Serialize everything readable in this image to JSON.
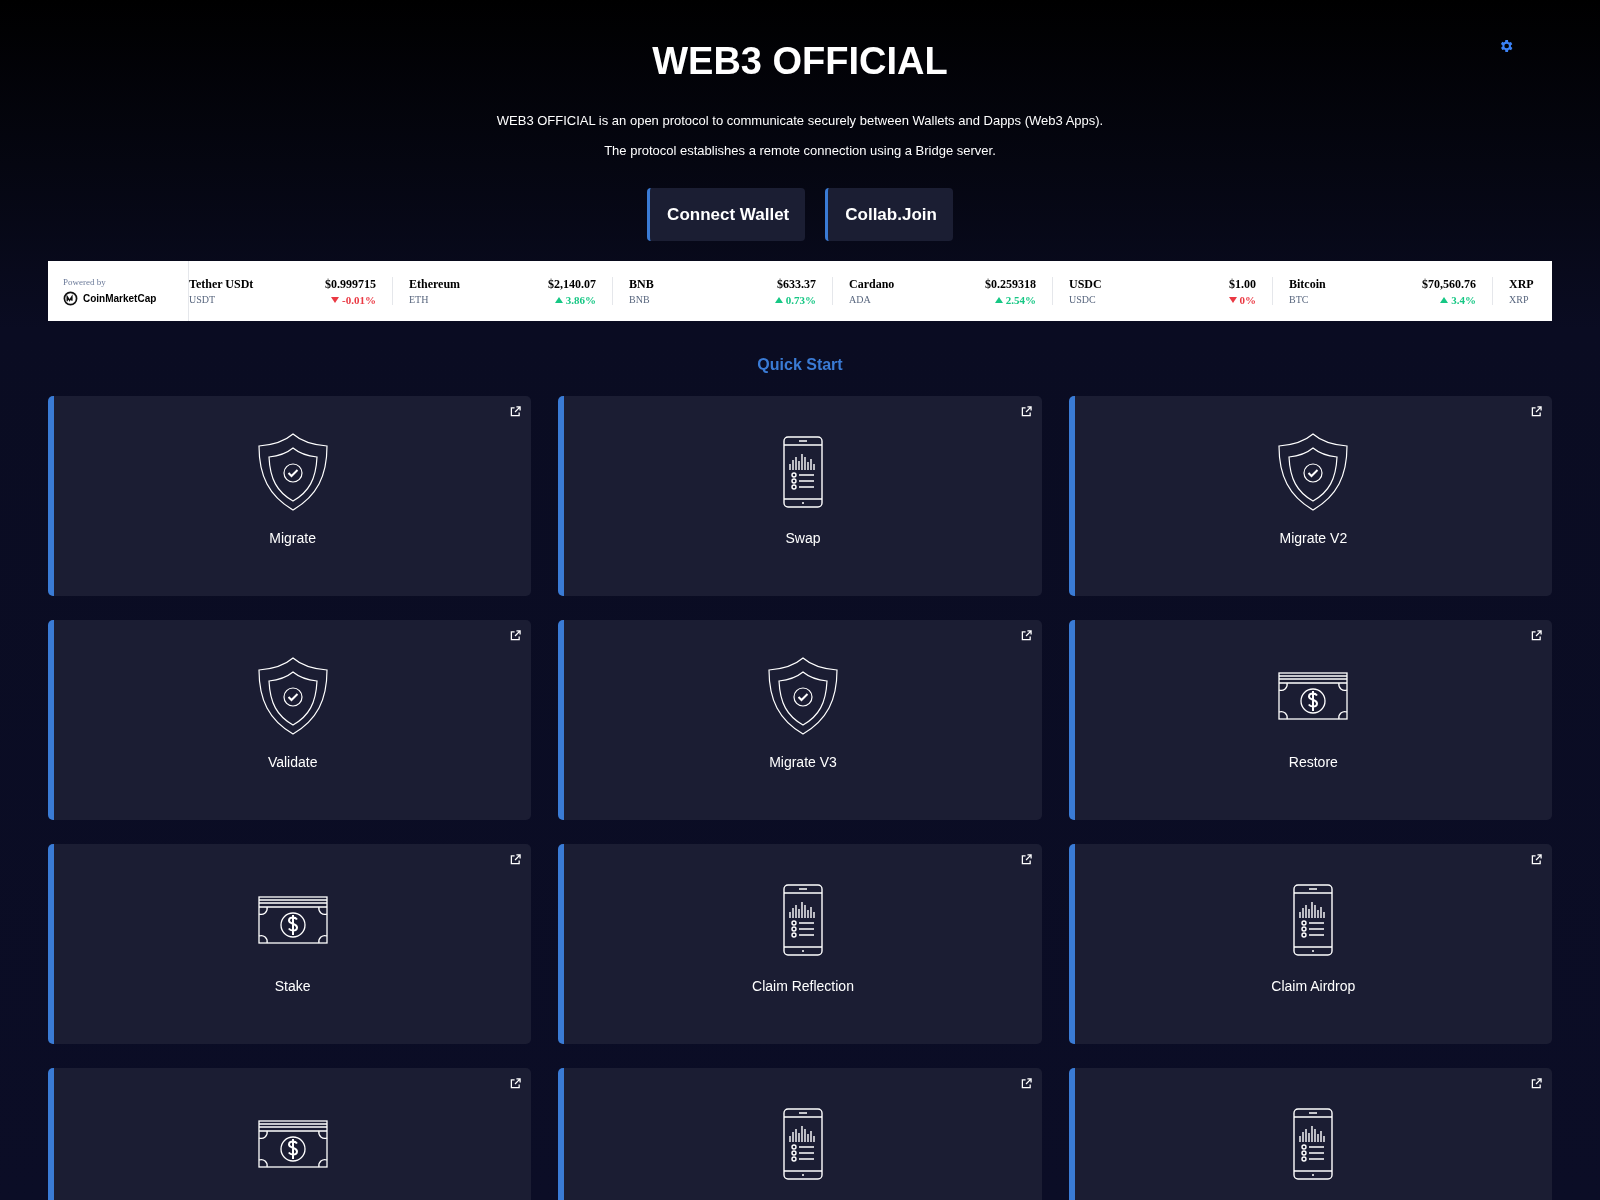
{
  "header": {
    "title": "WEB3 OFFICIAL",
    "lines": [
      "WEB3 OFFICIAL is an open protocol to communicate securely between Wallets and Dapps (Web3 Apps).",
      "The protocol establishes a remote connection using a Bridge server."
    ]
  },
  "buttons": [
    "Connect Wallet",
    "Collab.Join"
  ],
  "ticker": {
    "powered_by": "Powered by",
    "brand": "CoinMarketCap",
    "coins": [
      {
        "name": "Tether USDt",
        "symbol": "USDT",
        "price": "$0.999715",
        "change": "-0.01%",
        "falling": true
      },
      {
        "name": "Ethereum",
        "symbol": "ETH",
        "price": "$2,140.07",
        "change": "3.86%",
        "falling": false
      },
      {
        "name": "BNB",
        "symbol": "BNB",
        "price": "$633.37",
        "change": "0.73%",
        "falling": false
      },
      {
        "name": "Cardano",
        "symbol": "ADA",
        "price": "$0.259318",
        "change": "2.54%",
        "falling": false
      },
      {
        "name": "USDC",
        "symbol": "USDC",
        "price": "$1.00",
        "change": "0%",
        "falling": true
      },
      {
        "name": "Bitcoin",
        "symbol": "BTC",
        "price": "$70,560.76",
        "change": "3.4%",
        "falling": false
      },
      {
        "name": "XRP",
        "symbol": "XRP"
      }
    ]
  },
  "section_title": "Quick Start",
  "cards": [
    {
      "kind": "shield",
      "label": "Migrate"
    },
    {
      "kind": "phone",
      "label": "Swap"
    },
    {
      "kind": "shield",
      "label": "Migrate V2"
    },
    {
      "kind": "shield",
      "label": "Validate"
    },
    {
      "kind": "shield",
      "label": "Migrate V3"
    },
    {
      "kind": "cash",
      "label": "Restore"
    },
    {
      "kind": "cash",
      "label": "Stake"
    },
    {
      "kind": "phone",
      "label": "Claim Reflection"
    },
    {
      "kind": "phone",
      "label": "Claim Airdrop"
    },
    {
      "kind": "cash"
    },
    {
      "kind": "phone"
    },
    {
      "kind": "phone"
    }
  ]
}
